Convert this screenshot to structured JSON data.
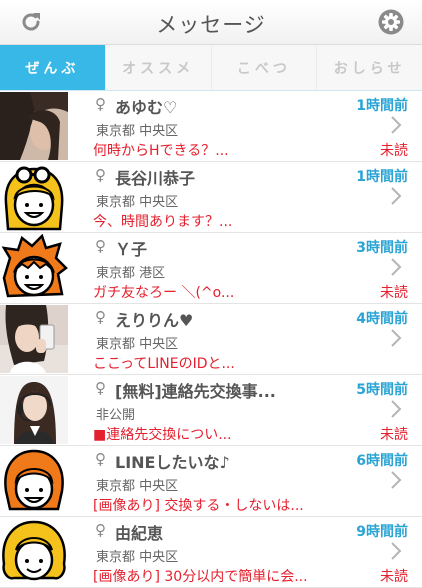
{
  "header": {
    "title": "メッセージ",
    "left_icon": "refresh-icon",
    "right_icon": "gear-icon"
  },
  "tabs": [
    {
      "label": "ぜんぶ",
      "active": true
    },
    {
      "label": "オススメ",
      "active": false
    },
    {
      "label": "こべつ",
      "active": false
    },
    {
      "label": "おしらせ",
      "active": false
    }
  ],
  "colors": {
    "accent": "#37b8e6",
    "time": "#2aa4d5",
    "alert": "#e5202e"
  },
  "messages": [
    {
      "gender": "♀",
      "name": "あゆむ♡",
      "time": "1時間前",
      "location": "東京都 中央区",
      "preview": "何時からHできる？...",
      "status": "未読",
      "avatar": "photo-dark-hair"
    },
    {
      "gender": "♀",
      "name": "長谷川恭子",
      "time": "1時間前",
      "location": "東京都 中央区",
      "preview": "今、時間あります？...",
      "status": "",
      "avatar": "cartoon-blonde-goggles"
    },
    {
      "gender": "♀",
      "name": "Ｙ子",
      "time": "3時間前",
      "location": "東京都 港区",
      "preview": "ガチ友なろー ＼(^o...",
      "status": "未読",
      "avatar": "cartoon-orange-spiky"
    },
    {
      "gender": "♀",
      "name": "えりりん♥",
      "time": "4時間前",
      "location": "東京都 中央区",
      "preview": "ここってLINEのIDと...",
      "status": "",
      "avatar": "photo-phone-selfie"
    },
    {
      "gender": "♀",
      "name": "[無料]連絡先交換事...",
      "time": "5時間前",
      "location": "非公開",
      "preview": "■連絡先交換につい...",
      "status": "未読",
      "avatar": "photo-headset"
    },
    {
      "gender": "♀",
      "name": "LINEしたいな♪",
      "time": "6時間前",
      "location": "東京都 中央区",
      "preview": "[画像あり] 交換する・しないは...",
      "status": "",
      "avatar": "cartoon-orange-bob"
    },
    {
      "gender": "♀",
      "name": "由紀恵",
      "time": "9時間前",
      "location": "東京都 中央区",
      "preview": "[画像あり] 30分以内で簡単に会...",
      "status": "未読",
      "avatar": "cartoon-blonde-curly"
    }
  ]
}
